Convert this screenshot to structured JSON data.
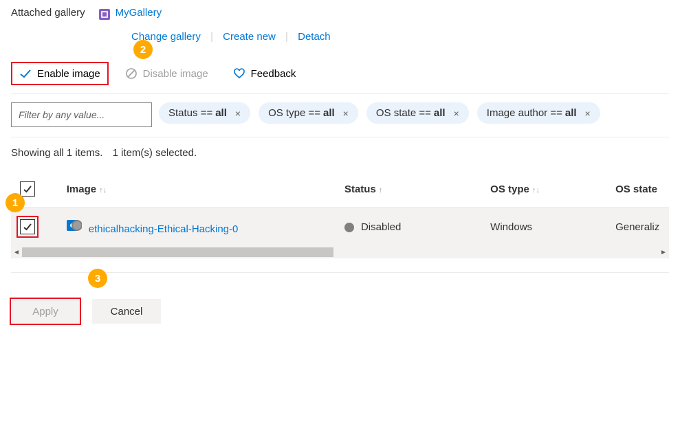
{
  "header": {
    "label": "Attached gallery",
    "gallery_name": "MyGallery",
    "links": {
      "change": "Change gallery",
      "create": "Create new",
      "detach": "Detach"
    }
  },
  "toolbar": {
    "enable_label": "Enable image",
    "disable_label": "Disable image",
    "feedback_label": "Feedback"
  },
  "callouts": {
    "one": "1",
    "two": "2",
    "three": "3"
  },
  "filters": {
    "placeholder": "Filter by any value...",
    "pills": [
      {
        "key": "Status ==",
        "value": "all"
      },
      {
        "key": "OS type ==",
        "value": "all"
      },
      {
        "key": "OS state ==",
        "value": "all"
      },
      {
        "key": "Image author ==",
        "value": "all"
      }
    ]
  },
  "summary": {
    "count": "Showing all 1 items.",
    "selected": "1 item(s) selected."
  },
  "table": {
    "columns": {
      "image": "Image",
      "status": "Status",
      "os_type": "OS type",
      "os_state": "OS state"
    },
    "rows": [
      {
        "name": "ethicalhacking-Ethical-Hacking-0",
        "status": "Disabled",
        "os_type": "Windows",
        "os_state": "Generaliz"
      }
    ]
  },
  "footer": {
    "apply": "Apply",
    "cancel": "Cancel"
  },
  "icons": {
    "gallery": "gallery-icon",
    "check": "check-icon",
    "forbid": "forbid-icon",
    "heart": "heart-icon",
    "vm": "vm-icon",
    "close": "×"
  }
}
